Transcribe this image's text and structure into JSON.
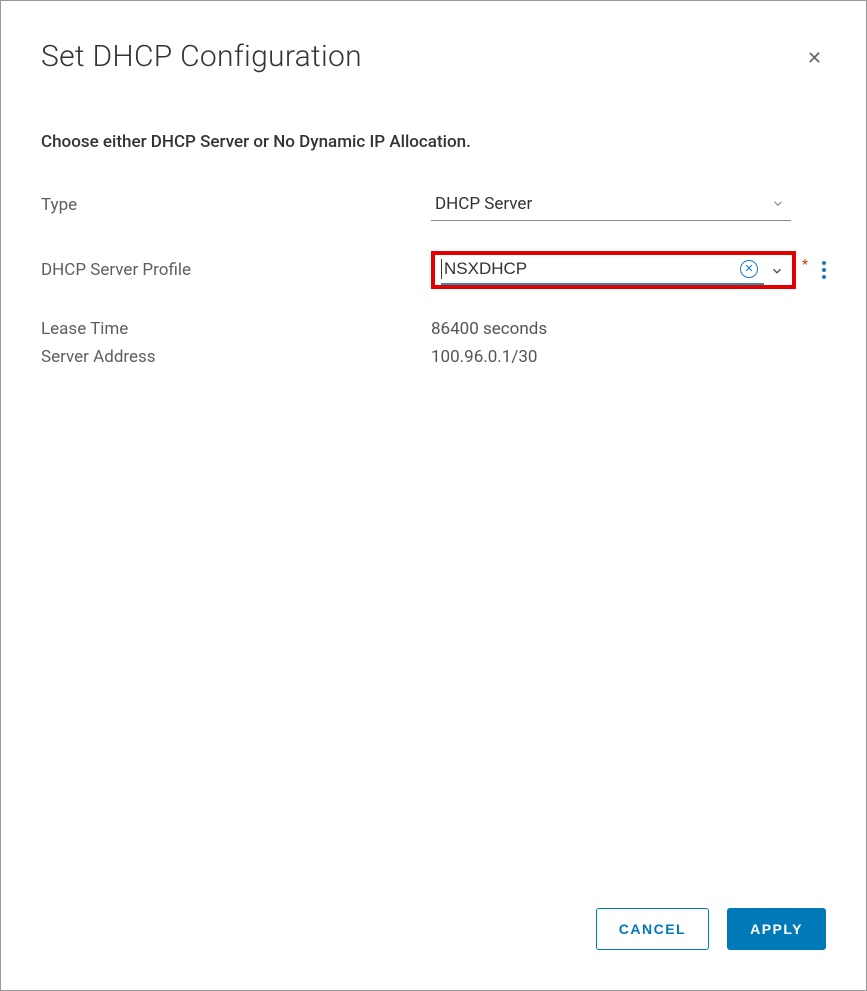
{
  "modal": {
    "title": "Set DHCP Configuration",
    "instruction": "Choose either DHCP Server or No Dynamic IP Allocation."
  },
  "form": {
    "type_label": "Type",
    "type_value": "DHCP Server",
    "profile_label": "DHCP Server Profile",
    "profile_value": "NSXDHCP",
    "lease_label": "Lease Time",
    "lease_value": "86400 seconds",
    "server_addr_label": "Server Address",
    "server_addr_value": "100.96.0.1/30"
  },
  "footer": {
    "cancel": "CANCEL",
    "apply": "APPLY"
  }
}
